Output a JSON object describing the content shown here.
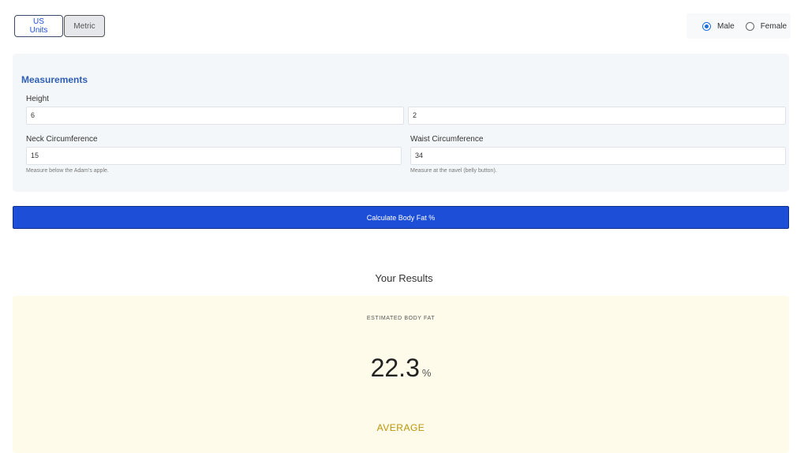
{
  "units": {
    "us_label": "US Units",
    "metric_label": "Metric",
    "selected": "US Units"
  },
  "gender": {
    "male_label": "Male",
    "female_label": "Female",
    "selected": "Male"
  },
  "measurements": {
    "title": "Measurements",
    "height_label": "Height",
    "height_feet": "6",
    "height_inches": "2",
    "neck_label": "Neck Circumference",
    "neck_value": "15",
    "neck_hint": "Measure below the Adam's apple.",
    "waist_label": "Waist Circumference",
    "waist_value": "34",
    "waist_hint": "Measure at the navel (belly button)."
  },
  "calculate_label": "Calculate Body Fat %",
  "results": {
    "title": "Your Results",
    "est_label": "ESTIMATED BODY FAT",
    "value": "22.3",
    "unit": "%",
    "category": "AVERAGE"
  },
  "colors": {
    "accent": "#1d4ed8",
    "category": "#b8960a",
    "results_bg": "#fefbea",
    "panel_bg": "#f4f7f9"
  }
}
